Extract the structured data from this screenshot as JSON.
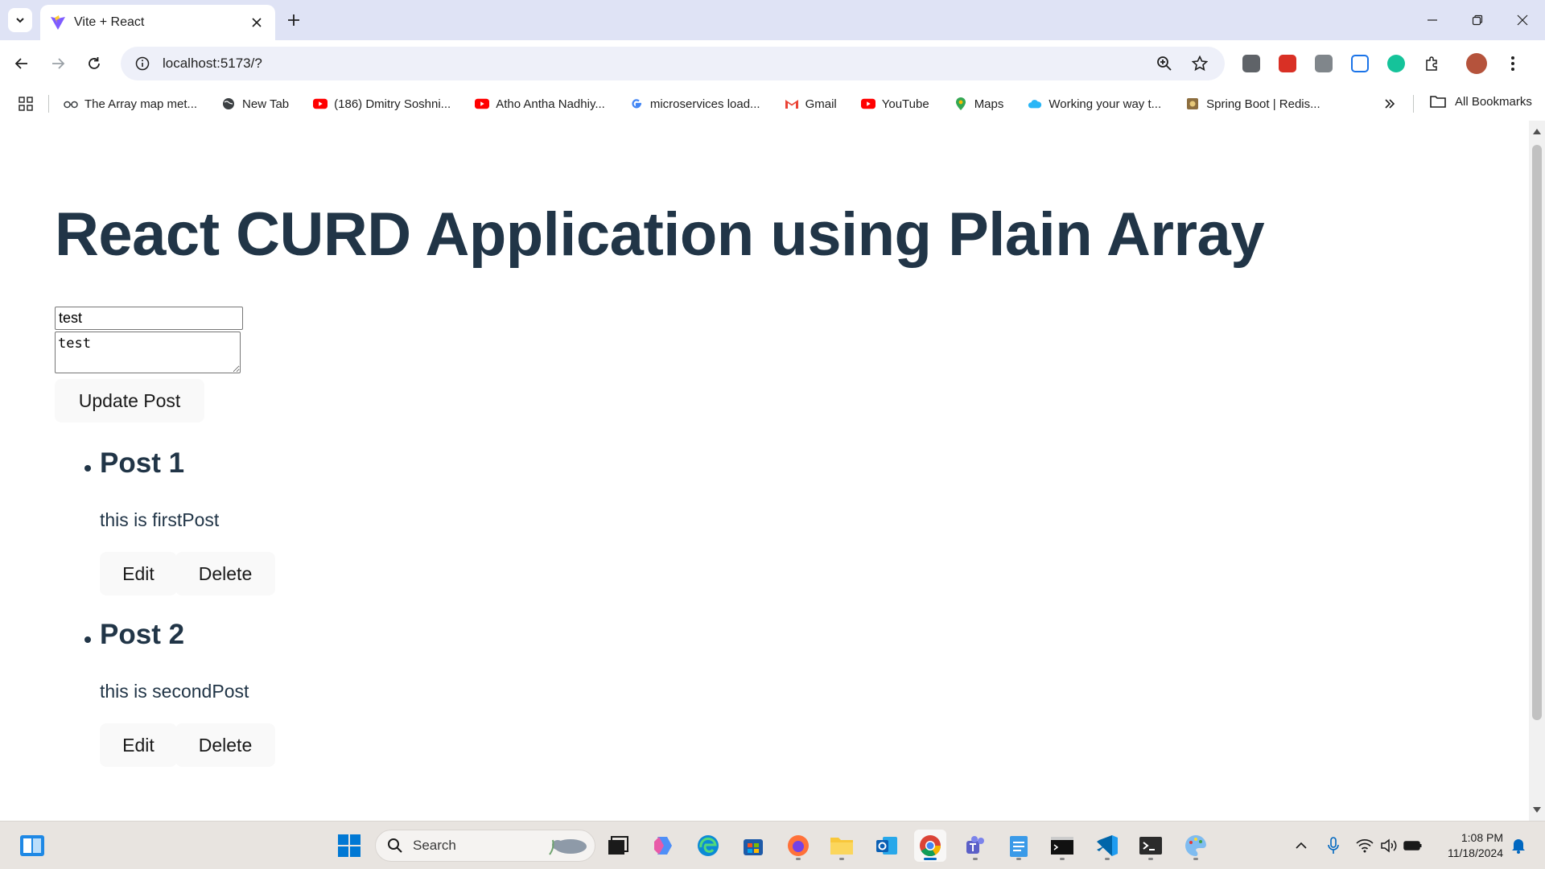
{
  "browser": {
    "tab_title": "Vite + React",
    "url": "localhost:5173/?",
    "bookmarks": [
      {
        "label": "The Array map met...",
        "icon": "glasses-icon"
      },
      {
        "label": "New Tab",
        "icon": "globe-icon"
      },
      {
        "label": "(186) Dmitry Soshni...",
        "icon": "youtube-icon"
      },
      {
        "label": "Atho Antha Nadhiy...",
        "icon": "youtube-icon"
      },
      {
        "label": "microservices load...",
        "icon": "google-icon"
      },
      {
        "label": "Gmail",
        "icon": "gmail-icon"
      },
      {
        "label": "YouTube",
        "icon": "youtube-icon"
      },
      {
        "label": "Maps",
        "icon": "maps-icon"
      },
      {
        "label": "Working your way t...",
        "icon": "cloud-icon"
      },
      {
        "label": "Spring Boot | Redis...",
        "icon": "spring-icon"
      }
    ],
    "all_bookmarks_label": "All Bookmarks",
    "colors": {
      "tabstrip": "#dfe3f5",
      "omnibox": "#eef0f9"
    }
  },
  "page": {
    "heading": "React CURD Application using Plain Array",
    "title_input_value": "test",
    "body_textarea_value": "test",
    "update_button_label": "Update Post",
    "posts": [
      {
        "title": "Post 1",
        "body": "this is firstPost",
        "edit_label": "Edit",
        "delete_label": "Delete"
      },
      {
        "title": "Post 2",
        "body": "this is secondPost",
        "edit_label": "Edit",
        "delete_label": "Delete"
      }
    ],
    "colors": {
      "text": "#213547",
      "button_bg": "#f9f9f9"
    }
  },
  "taskbar": {
    "search_label": "Search",
    "time": "1:08 PM",
    "date": "11/18/2024",
    "pinned": [
      "widgets-icon",
      "windows-start-icon",
      "task-view-icon",
      "copilot-icon",
      "edge-icon",
      "store-icon",
      "firefox-icon",
      "file-explorer-icon",
      "outlook-icon",
      "chrome-icon",
      "teams-icon",
      "notepad-icon",
      "cmd-icon",
      "vscode-icon",
      "terminal-icon",
      "paint-icon"
    ]
  }
}
